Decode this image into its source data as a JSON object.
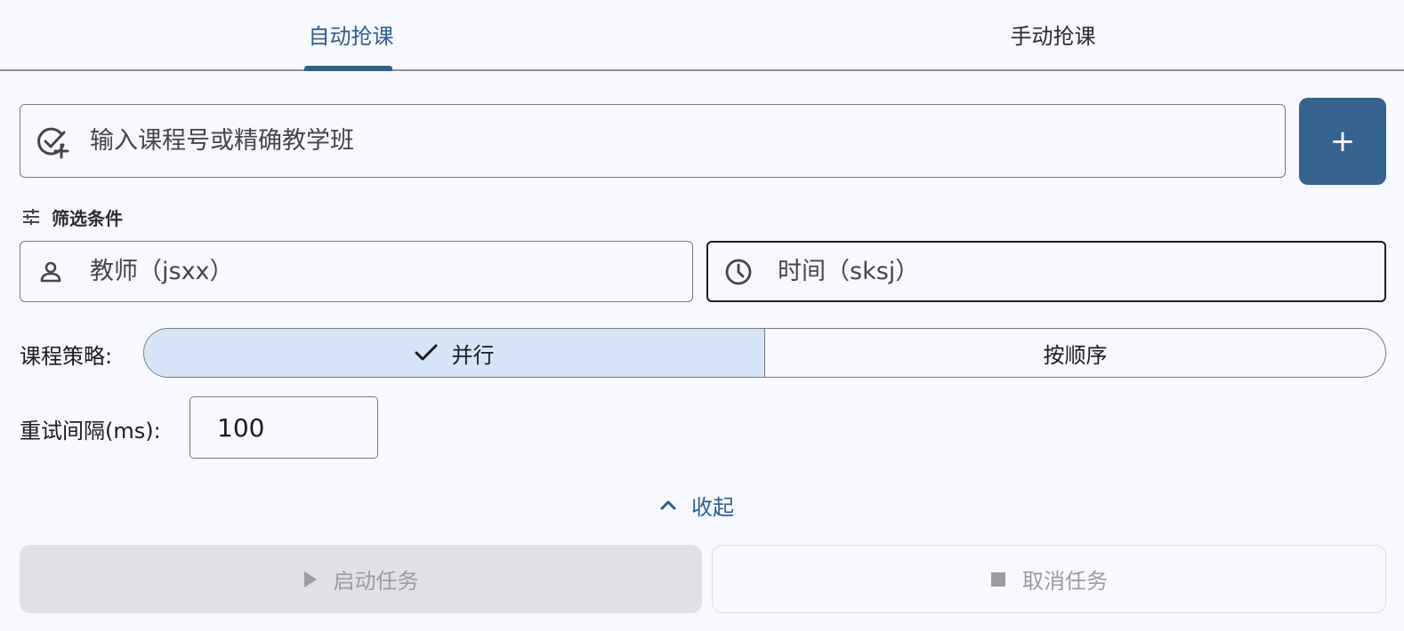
{
  "tabs": [
    {
      "label": "自动抢课",
      "active": true
    },
    {
      "label": "手动抢课",
      "active": false
    }
  ],
  "course_input": {
    "placeholder": "输入课程号或精确教学班",
    "value": "",
    "icon": "add-task-icon"
  },
  "add_button": {
    "label": "+"
  },
  "filter": {
    "title": "筛选条件",
    "icon": "tune-icon",
    "teacher": {
      "placeholder": "教师（jsxx）",
      "icon": "person-icon"
    },
    "time": {
      "placeholder": "时间（sksj）",
      "icon": "clock-icon"
    }
  },
  "strategy": {
    "label": "课程策略:",
    "options": [
      {
        "label": "并行",
        "selected": true
      },
      {
        "label": "按顺序",
        "selected": false
      }
    ]
  },
  "retry": {
    "label": "重试间隔(ms):",
    "value": "100"
  },
  "collapse": {
    "label": "收起",
    "icon": "chevron-up-icon"
  },
  "actions": {
    "start": {
      "label": "启动任务",
      "icon": "play-icon",
      "disabled": true
    },
    "cancel": {
      "label": "取消任务",
      "icon": "stop-icon",
      "disabled": true
    }
  },
  "colors": {
    "primary": "#35628f",
    "tab_active": "#2f5f8f",
    "segment_selected": "#d5e4f7",
    "background": "#f7f9fe",
    "disabled_bg": "#e0e1e5",
    "disabled_text": "#9a9ca0"
  }
}
